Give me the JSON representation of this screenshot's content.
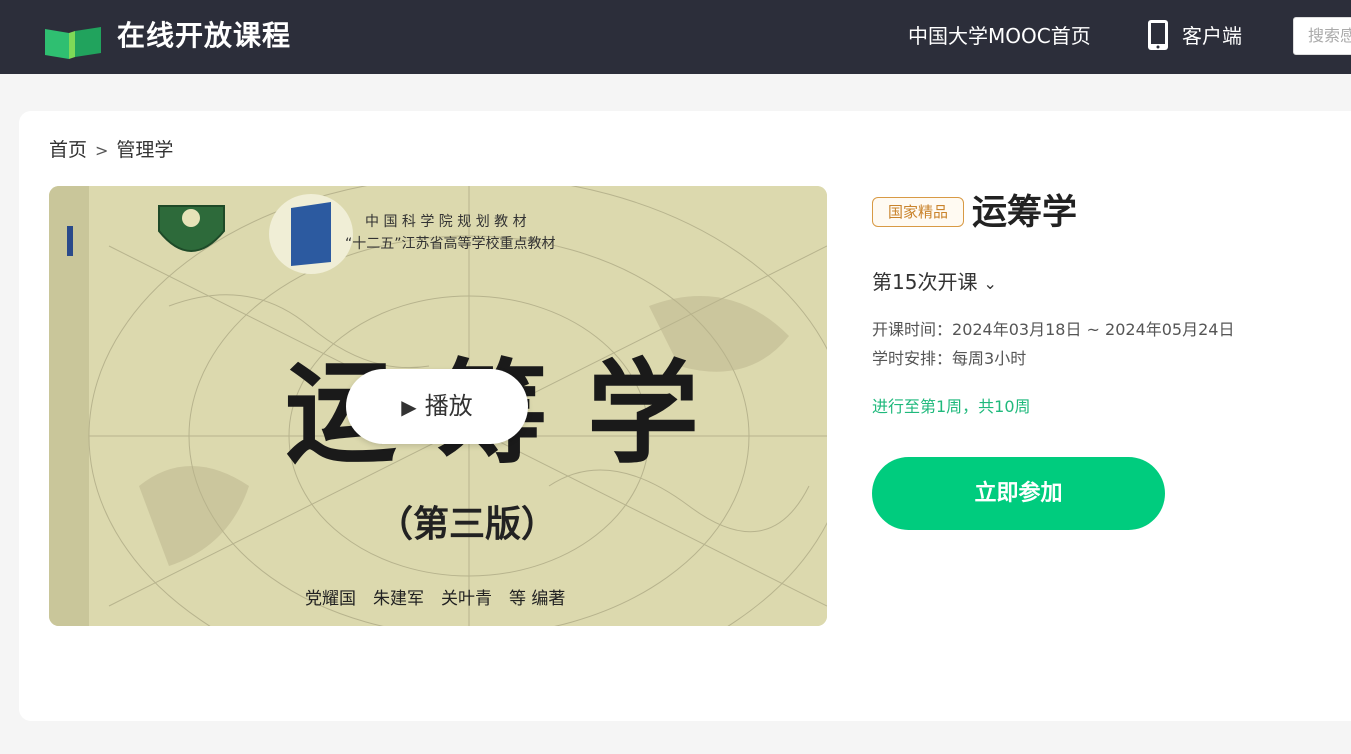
{
  "header": {
    "logo_text": "在线开放课程",
    "nav_home": "中国大学MOOC首页",
    "nav_client": "客户端",
    "search_placeholder": "搜索感兴趣的课程"
  },
  "breadcrumb": {
    "home": "首页",
    "separator": ">",
    "category": "管理学"
  },
  "cover": {
    "series_line1": "中 国 科 学 院 规 划 教 材",
    "series_line2": "“十二五”江苏省高等学校重点教材",
    "book_title": "运 筹 学",
    "edition": "（第三版）",
    "authors": "党耀国　朱建军　关叶青　等 编著",
    "play_label": "播放"
  },
  "course": {
    "badge": "国家精品",
    "title": "运筹学",
    "session": "第15次开课",
    "time_label": "开课时间：",
    "time_value": "2024年03月18日 ~ 2024年05月24日",
    "hours_label": "学时安排：",
    "hours_value": "每周3小时",
    "progress": "进行至第1周，共10周",
    "join_label": "立即参加"
  },
  "colors": {
    "header_bg": "#2c2e3a",
    "accent_green": "#00cc7e",
    "badge_gold": "#c9832c"
  }
}
